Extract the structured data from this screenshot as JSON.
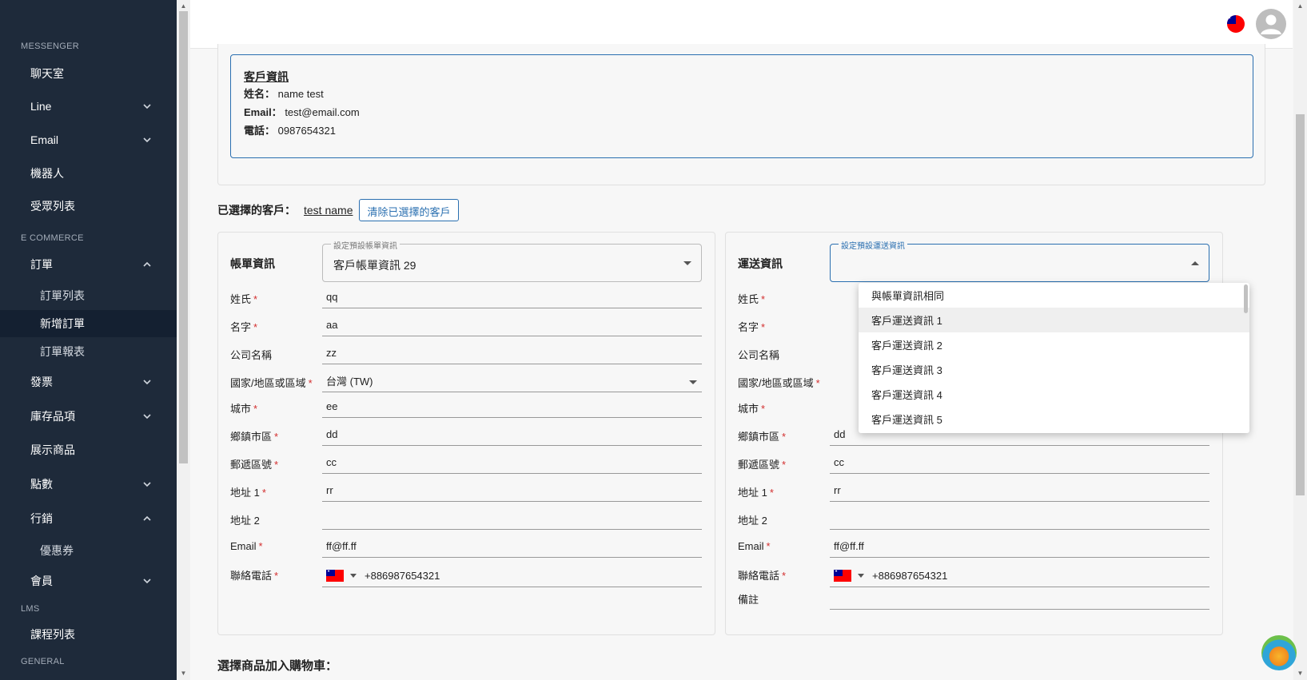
{
  "sidebar": {
    "sections": {
      "messenger": "MESSENGER",
      "ecommerce": "E COMMERCE",
      "lms": "LMS",
      "general": "GENERAL"
    },
    "items": {
      "chatroom": "聊天室",
      "line": "Line",
      "email": "Email",
      "bot": "機器人",
      "audience": "受眾列表",
      "orders": "訂單",
      "order_list": "訂單列表",
      "new_order": "新增訂單",
      "order_report": "訂單報表",
      "invoice": "發票",
      "inventory": "庫存品項",
      "showcase": "展示商品",
      "points": "點數",
      "marketing": "行銷",
      "coupon": "優惠券",
      "members": "會員",
      "course_list": "課程列表"
    }
  },
  "customer_info": {
    "title": "客戶資訊",
    "name_label": "姓名：",
    "name_value": "name test",
    "email_label": "Email：",
    "email_value": "test@email.com",
    "phone_label": "電話：",
    "phone_value": "0987654321"
  },
  "selected_customer": {
    "label": "已選擇的客戶：",
    "name": "test name",
    "clear_button": "清除已選擇的客戶"
  },
  "billing": {
    "title": "帳單資訊",
    "preset_legend": "設定預設帳單資訊",
    "preset_value": "客戶帳單資訊 29",
    "labels": {
      "last_name": "姓氏",
      "first_name": "名字",
      "company": "公司名稱",
      "country": "國家/地區或區域",
      "city": "城市",
      "district": "鄉鎮市區",
      "zip": "郵遞區號",
      "address1": "地址 1",
      "address2": "地址 2",
      "email": "Email",
      "phone": "聯絡電話"
    },
    "values": {
      "last_name": "qq",
      "first_name": "aa",
      "company": "zz",
      "country": "台灣 (TW)",
      "city": "ee",
      "district": "dd",
      "zip": "cc",
      "address1": "rr",
      "address2": "",
      "email": "ff@ff.ff",
      "phone": "+886987654321"
    }
  },
  "shipping": {
    "title": "運送資訊",
    "preset_legend": "設定預設運送資訊",
    "preset_value": "",
    "labels": {
      "last_name": "姓氏",
      "first_name": "名字",
      "company": "公司名稱",
      "country": "國家/地區或區域",
      "city": "城市",
      "district": "鄉鎮市區",
      "zip": "郵遞區號",
      "address1": "地址 1",
      "address2": "地址 2",
      "email": "Email",
      "phone": "聯絡電話",
      "note": "備註"
    },
    "values": {
      "district": "dd",
      "zip": "cc",
      "address1": "rr",
      "address2": "",
      "email": "ff@ff.ff",
      "phone": "+886987654321",
      "note": ""
    },
    "dropdown_options": [
      "與帳單資訊相同",
      "客戶運送資訊 1",
      "客戶運送資訊 2",
      "客戶運送資訊 3",
      "客戶運送資訊 4",
      "客戶運送資訊 5"
    ],
    "highlighted_option": "客戶運送資訊 1"
  },
  "required_mark": "*",
  "cart_title": "選擇商品加入購物車："
}
